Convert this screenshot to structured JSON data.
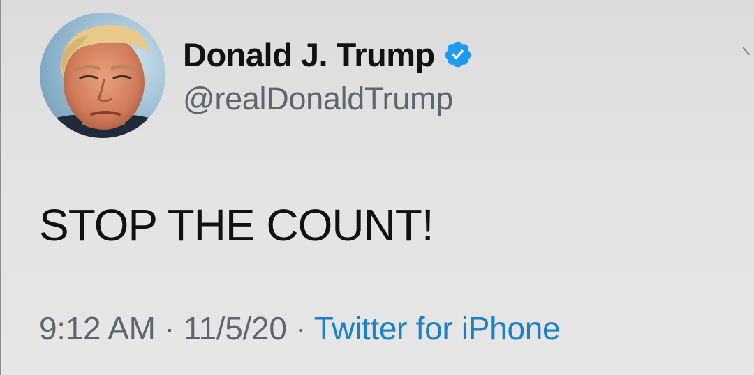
{
  "tweet": {
    "author": {
      "display_name": "Donald J. Trump",
      "handle": "@realDonaldTrump",
      "verified": true
    },
    "text": "STOP THE COUNT!",
    "time": "9:12 AM",
    "separator": "·",
    "date": "11/5/20",
    "source": "Twitter for iPhone"
  },
  "colors": {
    "verified_badge": "#1d9bf0",
    "source_link": "#1b80c4",
    "muted_text": "#5e656c"
  },
  "icons": {
    "verified": "verified-badge-icon",
    "more": "chevron-down-icon"
  }
}
